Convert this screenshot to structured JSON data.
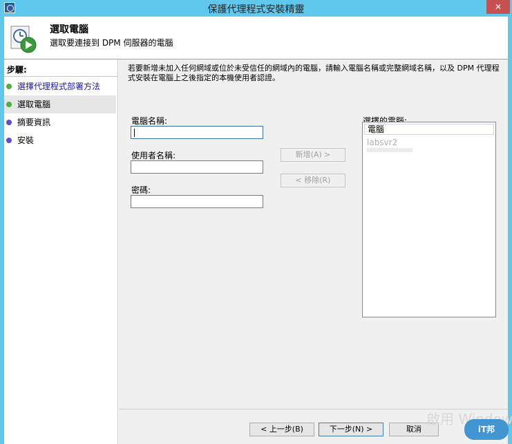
{
  "window": {
    "title": "保護代理程式安裝精靈",
    "close_glyph": "✕",
    "accent_color": "#5fc8ec"
  },
  "header": {
    "title": "選取電腦",
    "subtitle": "選取要連接到 DPM 伺服器的電腦"
  },
  "steps": {
    "heading": "步驟:",
    "items": [
      {
        "label": "選擇代理程式部署方法",
        "dot_color": "#4fb03b",
        "state": "done"
      },
      {
        "label": "選取電腦",
        "dot_color": "#4fb03b",
        "state": "current"
      },
      {
        "label": "摘要資訊",
        "dot_color": "#5b4fcf",
        "state": "pending"
      },
      {
        "label": "安裝",
        "dot_color": "#5b4fcf",
        "state": "pending"
      }
    ]
  },
  "main": {
    "instruction": "若要新增未加入任何網域或位於未受信任的網域內的電腦，請輸入電腦名稱或完整網域名稱，以及 DPM 代理程式安裝在電腦上之後指定的本機使用者認證。",
    "computer_name_label": "電腦名稱:",
    "computer_name_value": "",
    "username_label": "使用者名稱:",
    "username_value": "",
    "password_label": "密碼:",
    "password_value": "",
    "add_button": "新增(A) >",
    "remove_button": "< 移除(R)",
    "selected_label": "選擇的電腦:",
    "list_header": "電腦",
    "selected_computers": [
      "labsvr2"
    ]
  },
  "footer": {
    "back_button": "< 上一步(B)",
    "next_button": "下一步(N) >",
    "cancel_button": "取消"
  },
  "overlay": {
    "activation_text": "啟用 Windows",
    "logo_text": "iT邦"
  }
}
